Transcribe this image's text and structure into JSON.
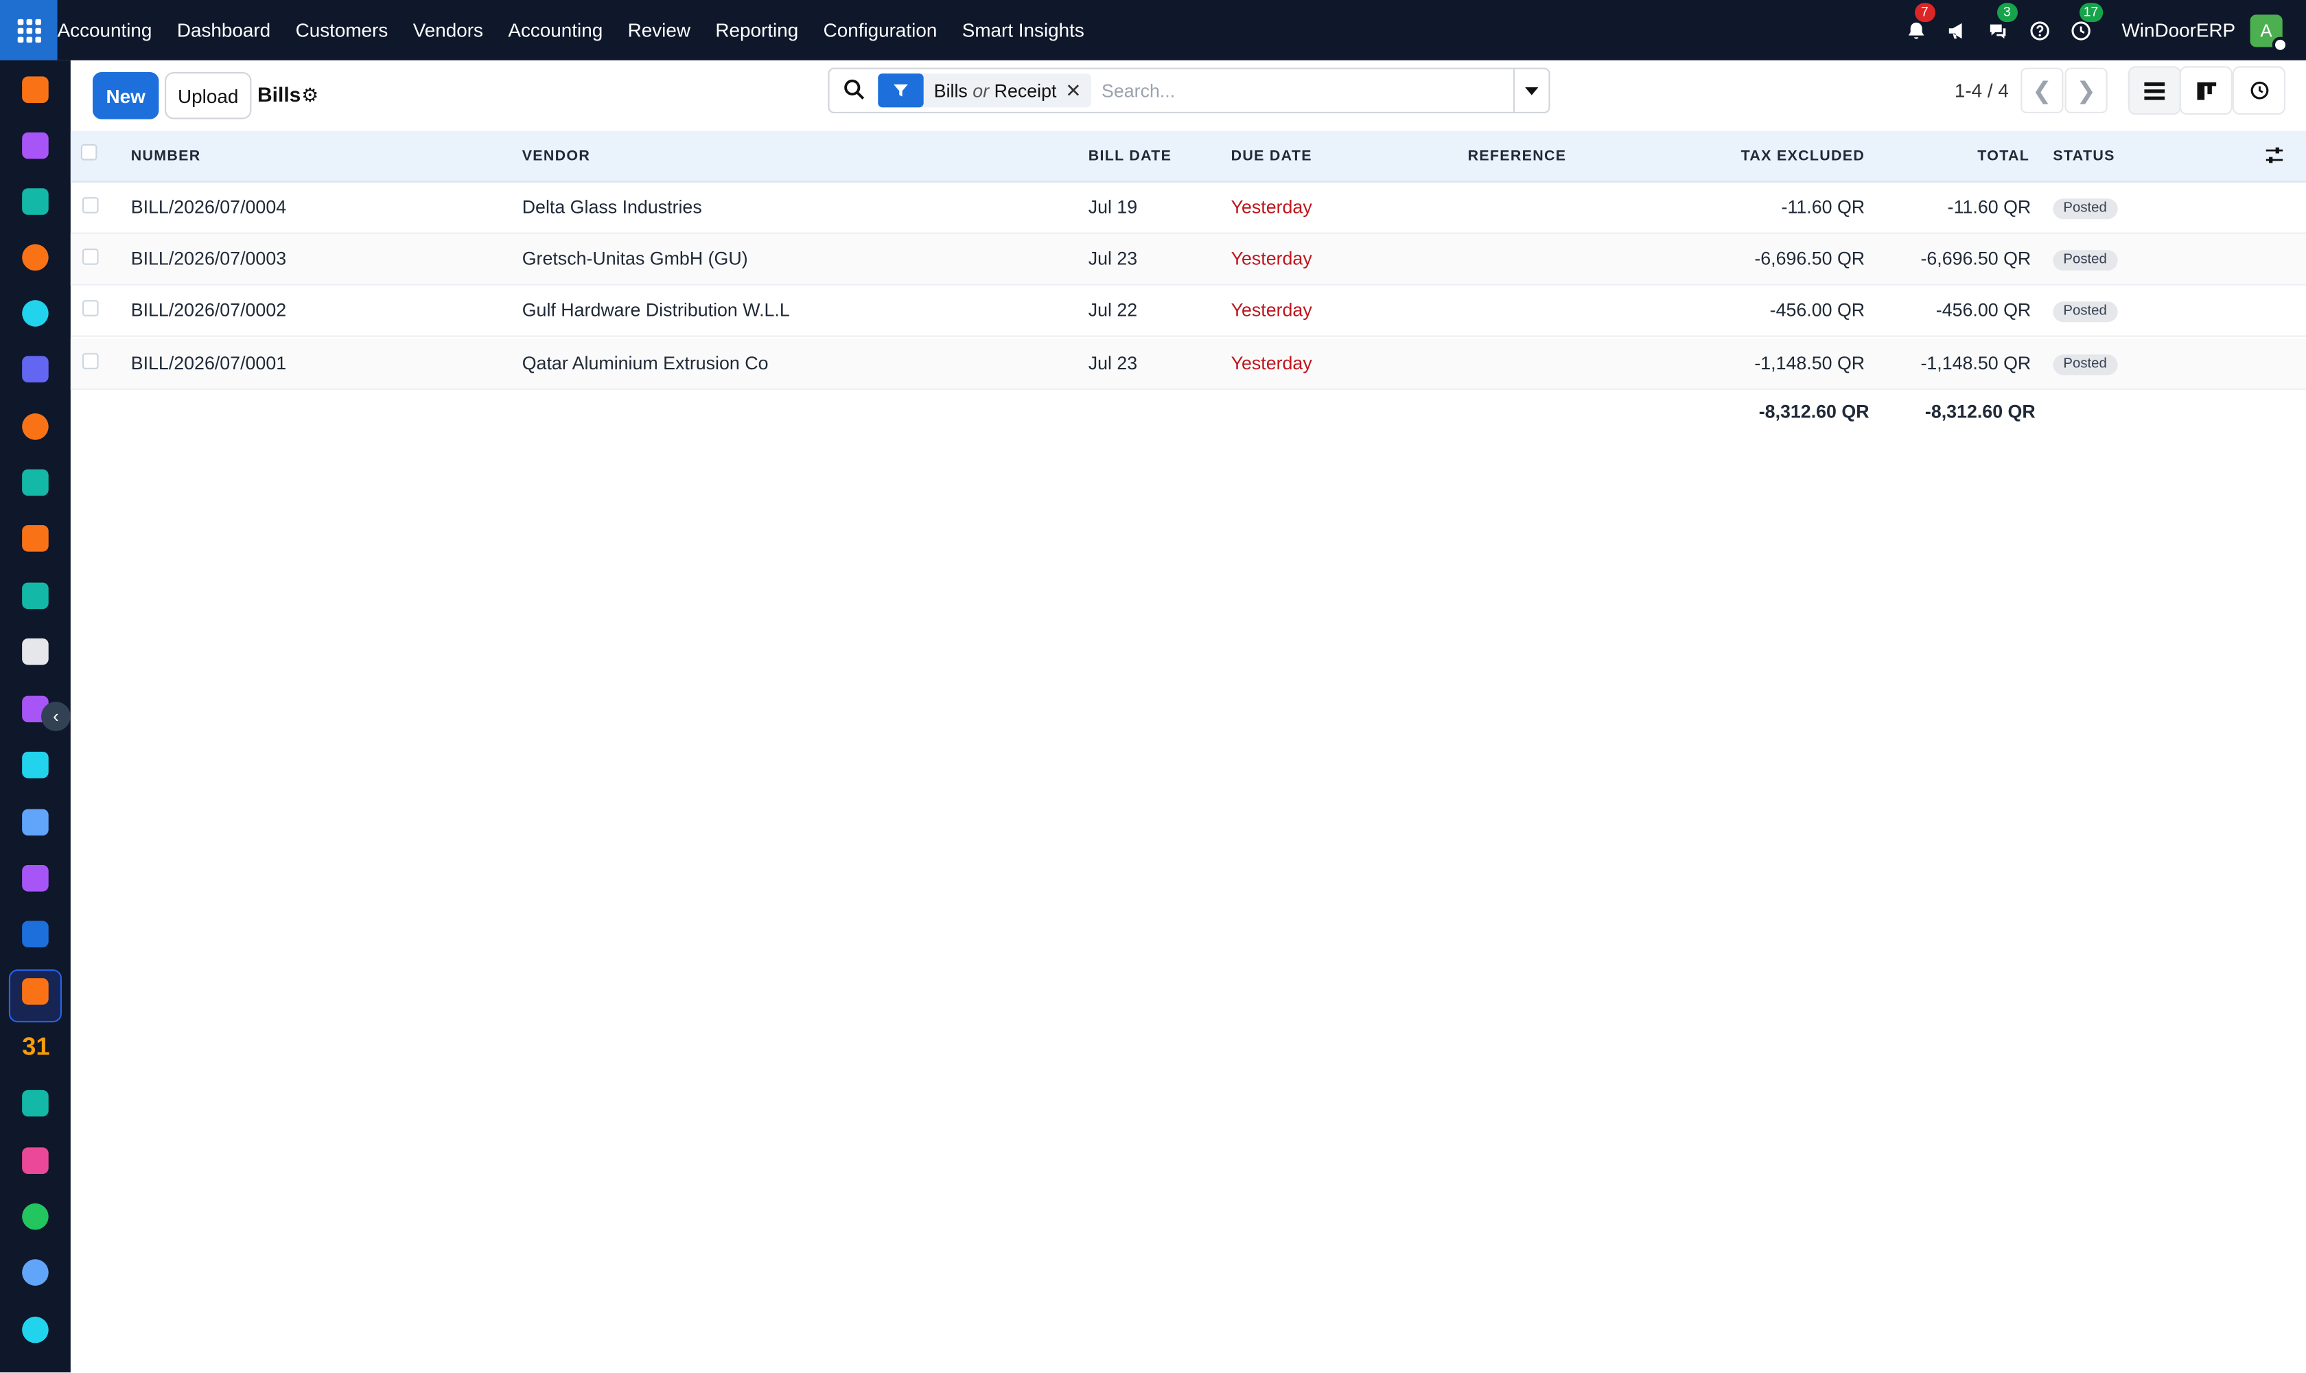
{
  "nav": {
    "app_name": "Accounting",
    "menu": [
      "Dashboard",
      "Customers",
      "Vendors",
      "Accounting",
      "Review",
      "Reporting",
      "Configuration",
      "Smart Insights"
    ],
    "notifications_count": "7",
    "messages_count": "3",
    "activities_count": "17",
    "company": "WinDoorERP",
    "avatar_letter": "A"
  },
  "control": {
    "new_label": "New",
    "upload_label": "Upload",
    "title": "Bills",
    "facet_value_1": "Bills",
    "facet_or": "or",
    "facet_value_2": "Receipt",
    "search_placeholder": "Search...",
    "pager": "1-4 / 4"
  },
  "table": {
    "columns": {
      "number": "NUMBER",
      "vendor": "VENDOR",
      "bill_date": "BILL DATE",
      "due_date": "DUE DATE",
      "reference": "REFERENCE",
      "tax_excluded": "TAX EXCLUDED",
      "total": "TOTAL",
      "status": "STATUS"
    },
    "rows": [
      {
        "number": "BILL/2026/07/0004",
        "vendor": "Delta Glass Industries",
        "bill_date": "Jul 19",
        "due_date": "Yesterday",
        "reference": "",
        "tax_excluded": "-11.60 QR",
        "total": "-11.60 QR",
        "status": "Posted"
      },
      {
        "number": "BILL/2026/07/0003",
        "vendor": "Gretsch-Unitas GmbH (GU)",
        "bill_date": "Jul 23",
        "due_date": "Yesterday",
        "reference": "",
        "tax_excluded": "-6,696.50 QR",
        "total": "-6,696.50 QR",
        "status": "Posted"
      },
      {
        "number": "BILL/2026/07/0002",
        "vendor": "Gulf Hardware Distribution W.L.L",
        "bill_date": "Jul 22",
        "due_date": "Yesterday",
        "reference": "",
        "tax_excluded": "-456.00 QR",
        "total": "-456.00 QR",
        "status": "Posted"
      },
      {
        "number": "BILL/2026/07/0001",
        "vendor": "Qatar Aluminium Extrusion Co",
        "bill_date": "Jul 23",
        "due_date": "Yesterday",
        "reference": "",
        "tax_excluded": "-1,148.50 QR",
        "total": "-1,148.50 QR",
        "status": "Posted"
      }
    ],
    "totals": {
      "tax_excluded": "-8,312.60 QR",
      "total": "-8,312.60 QR"
    }
  },
  "sidebar": {
    "apps": [
      {
        "icon": "sales-icon",
        "color": "#f97316"
      },
      {
        "icon": "pos-icon",
        "color": "#a855f7"
      },
      {
        "icon": "contacts-icon",
        "color": "#14b8a6"
      },
      {
        "icon": "discuss-icon",
        "color": "#f97316"
      },
      {
        "icon": "website-icon",
        "color": "#22d3ee"
      },
      {
        "icon": "email-marketing-icon",
        "color": "#6366f1"
      },
      {
        "icon": "livechat-icon",
        "color": "#f97316"
      },
      {
        "icon": "crm-icon",
        "color": "#14b8a6"
      },
      {
        "icon": "reports-icon",
        "color": "#f97316"
      },
      {
        "icon": "employees-icon",
        "color": "#14b8a6"
      },
      {
        "icon": "inventory-icon",
        "color": "#e5e7eb"
      },
      {
        "icon": "point-of-sale-icon",
        "color": "#a855f7"
      },
      {
        "icon": "todo-icon",
        "color": "#22d3ee"
      },
      {
        "icon": "knowledge-icon",
        "color": "#60a5fa"
      },
      {
        "icon": "purchase-icon",
        "color": "#a855f7"
      },
      {
        "icon": "accounting-icon",
        "color": "#1d6fdc"
      },
      {
        "icon": "team-icon",
        "color": "#f97316"
      },
      {
        "icon": "calendar-icon",
        "color": "#f59e0b"
      },
      {
        "icon": "sign-icon",
        "color": "#14b8a6"
      },
      {
        "icon": "dashboards-icon",
        "color": "#ec4899"
      },
      {
        "icon": "whatsapp-icon",
        "color": "#22c55e"
      },
      {
        "icon": "timesheets-icon",
        "color": "#60a5fa"
      },
      {
        "icon": "website-2-icon",
        "color": "#22d3ee"
      }
    ]
  },
  "colors": {
    "primary": "#1d6fdc",
    "nav_bg": "#0f172a",
    "overdue": "#c0151d"
  }
}
